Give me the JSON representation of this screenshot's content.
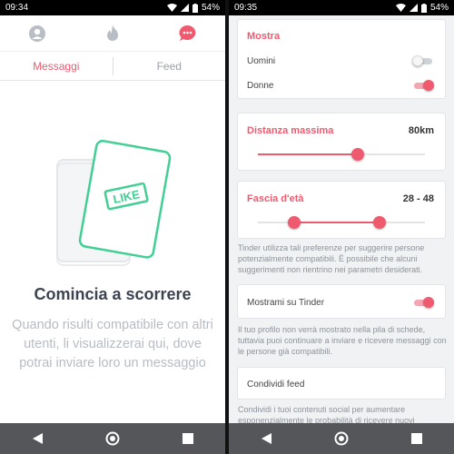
{
  "left": {
    "status": {
      "time": "09:34",
      "battery": "54%"
    },
    "tabs": {
      "messages": "Messaggi",
      "feed": "Feed"
    },
    "illustration": {
      "stamp": "LIKE"
    },
    "empty": {
      "title": "Comincia a scorrere",
      "text": "Quando risulti compatibile con altri utenti, li visualizzerai qui, dove potrai inviare loro un messaggio"
    }
  },
  "right": {
    "status": {
      "time": "09:35",
      "battery": "54%"
    },
    "show": {
      "title": "Mostra",
      "men": {
        "label": "Uomini",
        "on": false
      },
      "women": {
        "label": "Donne",
        "on": true
      }
    },
    "distance": {
      "title": "Distanza massima",
      "value": "80km",
      "fraction": 0.6
    },
    "age": {
      "title": "Fascia d'età",
      "value": "28 - 48",
      "low_fraction": 0.22,
      "high_fraction": 0.73
    },
    "age_note": "Tinder utilizza tali preferenze per suggerire persone potenzialmente compatibili. È possibile che alcuni suggerimenti non rientrino nei parametri desiderati.",
    "show_me": {
      "label": "Mostrami su Tinder",
      "on": true
    },
    "show_me_note": "Il tuo profilo non verrà mostrato nella pila di schede, tuttavia puoi continuare a inviare e ricevere messaggi con le persone già compatibili.",
    "share_feed": {
      "label": "Condividi feed"
    },
    "share_note": "Condividi i tuoi contenuti social per aumentare esponenzialmente le probabilità di ricevere nuovi"
  },
  "colors": {
    "accent": "#ef5a6f",
    "navbar": "#555659"
  },
  "icons": {
    "top": [
      "profile-icon",
      "flame-icon",
      "chat-icon"
    ],
    "nav": [
      "back-icon",
      "home-icon",
      "recents-icon"
    ]
  }
}
